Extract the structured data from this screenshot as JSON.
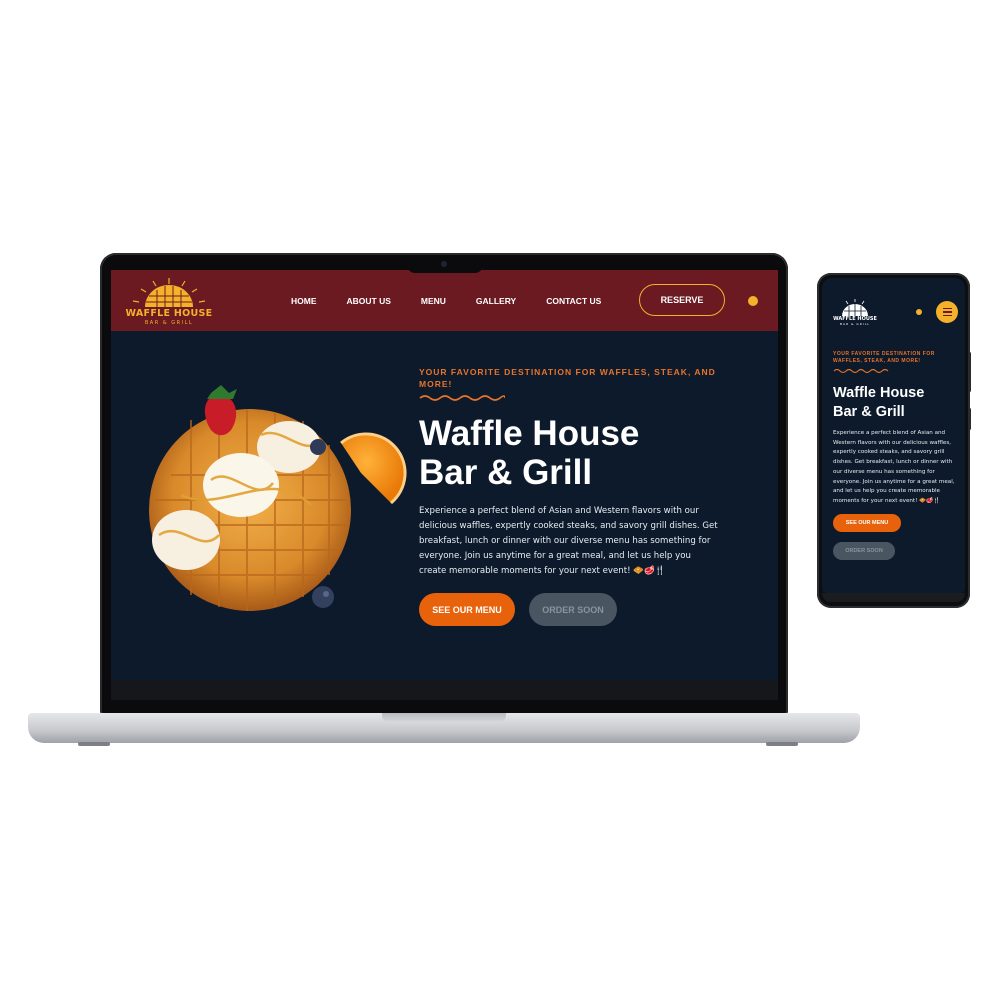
{
  "site": {
    "logo_text": "WAFFLE HOUSE",
    "logo_subtext": "BAR & GRILL"
  },
  "nav": {
    "items": [
      "HOME",
      "ABOUT US",
      "MENU",
      "GALLERY",
      "CONTACT US"
    ],
    "reserve_label": "RESERVE"
  },
  "hero": {
    "eyebrow": "YOUR FAVORITE DESTINATION FOR WAFFLES, STEAK, AND MORE!",
    "title_line1": "Waffle House",
    "title_line2": "Bar & Grill",
    "description": "Experience a perfect blend of Asian and Western flavors with our delicious waffles, expertly cooked steaks, and savory grill dishes. Get breakfast, lunch or dinner with our diverse menu has something for everyone. Join us anytime for a great meal, and let us help you create memorable moments for your next event! 🧇🥩🍴",
    "primary_button": "SEE OUR MENU",
    "secondary_button": "ORDER SOON"
  },
  "colors": {
    "nav_bg": "#6b1a22",
    "hero_bg": "#0c1a2b",
    "accent_gold": "#f5b12a",
    "accent_orange": "#e8620c",
    "disabled_button": "#4a5562"
  },
  "icons": [
    "waffle-house-logo-icon",
    "theme-toggle-dot-icon",
    "hamburger-menu-icon",
    "squiggle-divider-icon",
    "waffle-dessert-image"
  ]
}
